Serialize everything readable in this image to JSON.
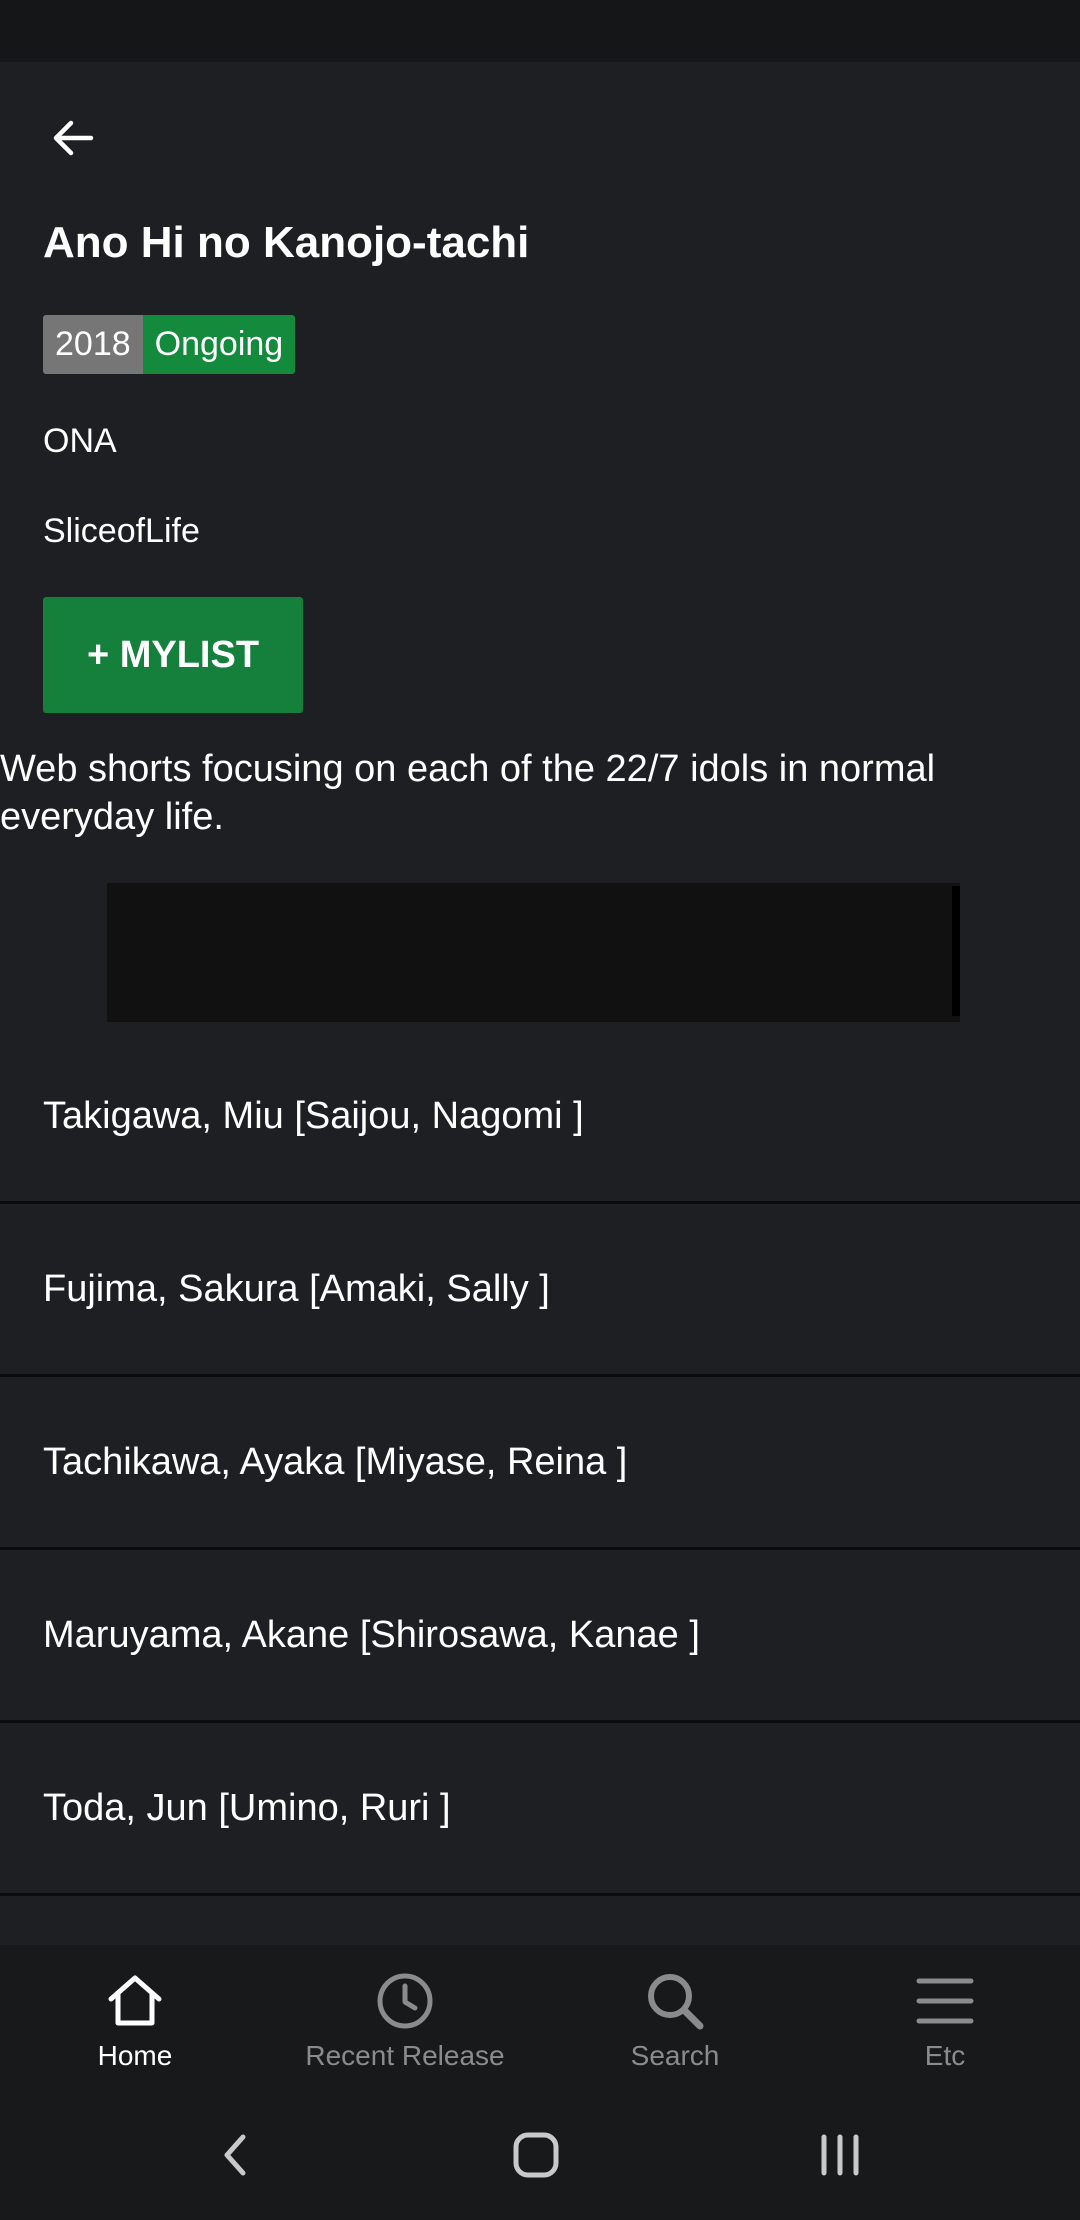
{
  "header": {
    "title": "Ano Hi no Kanojo-tachi"
  },
  "badges": {
    "year": "2018",
    "status": "Ongoing"
  },
  "meta": {
    "type": "ONA",
    "genre": "SliceofLife"
  },
  "mylist_button": {
    "label": "+ MYLIST"
  },
  "description": "Web shorts focusing on each of the 22/7 idols in normal everyday life.",
  "cast": [
    "Takigawa, Miu [Saijou, Nagomi ]",
    "Fujima, Sakura [Amaki, Sally ]",
    "Tachikawa, Ayaka [Miyase, Reina ]",
    "Maruyama, Akane [Shirosawa, Kanae ]",
    "Toda, Jun [Umino, Ruri ]"
  ],
  "bottom_nav": {
    "items": [
      {
        "label": "Home",
        "icon": "home-icon",
        "active": true
      },
      {
        "label": "Recent Release",
        "icon": "clock-icon",
        "active": false
      },
      {
        "label": "Search",
        "icon": "search-icon",
        "active": false
      },
      {
        "label": "Etc",
        "icon": "menu-icon",
        "active": false
      }
    ]
  },
  "colors": {
    "background": "#1e1f22",
    "accent_green": "#14803b",
    "badge_gray": "#767676",
    "badge_green": "#138a3c",
    "inactive_nav": "#8a8b8d"
  }
}
